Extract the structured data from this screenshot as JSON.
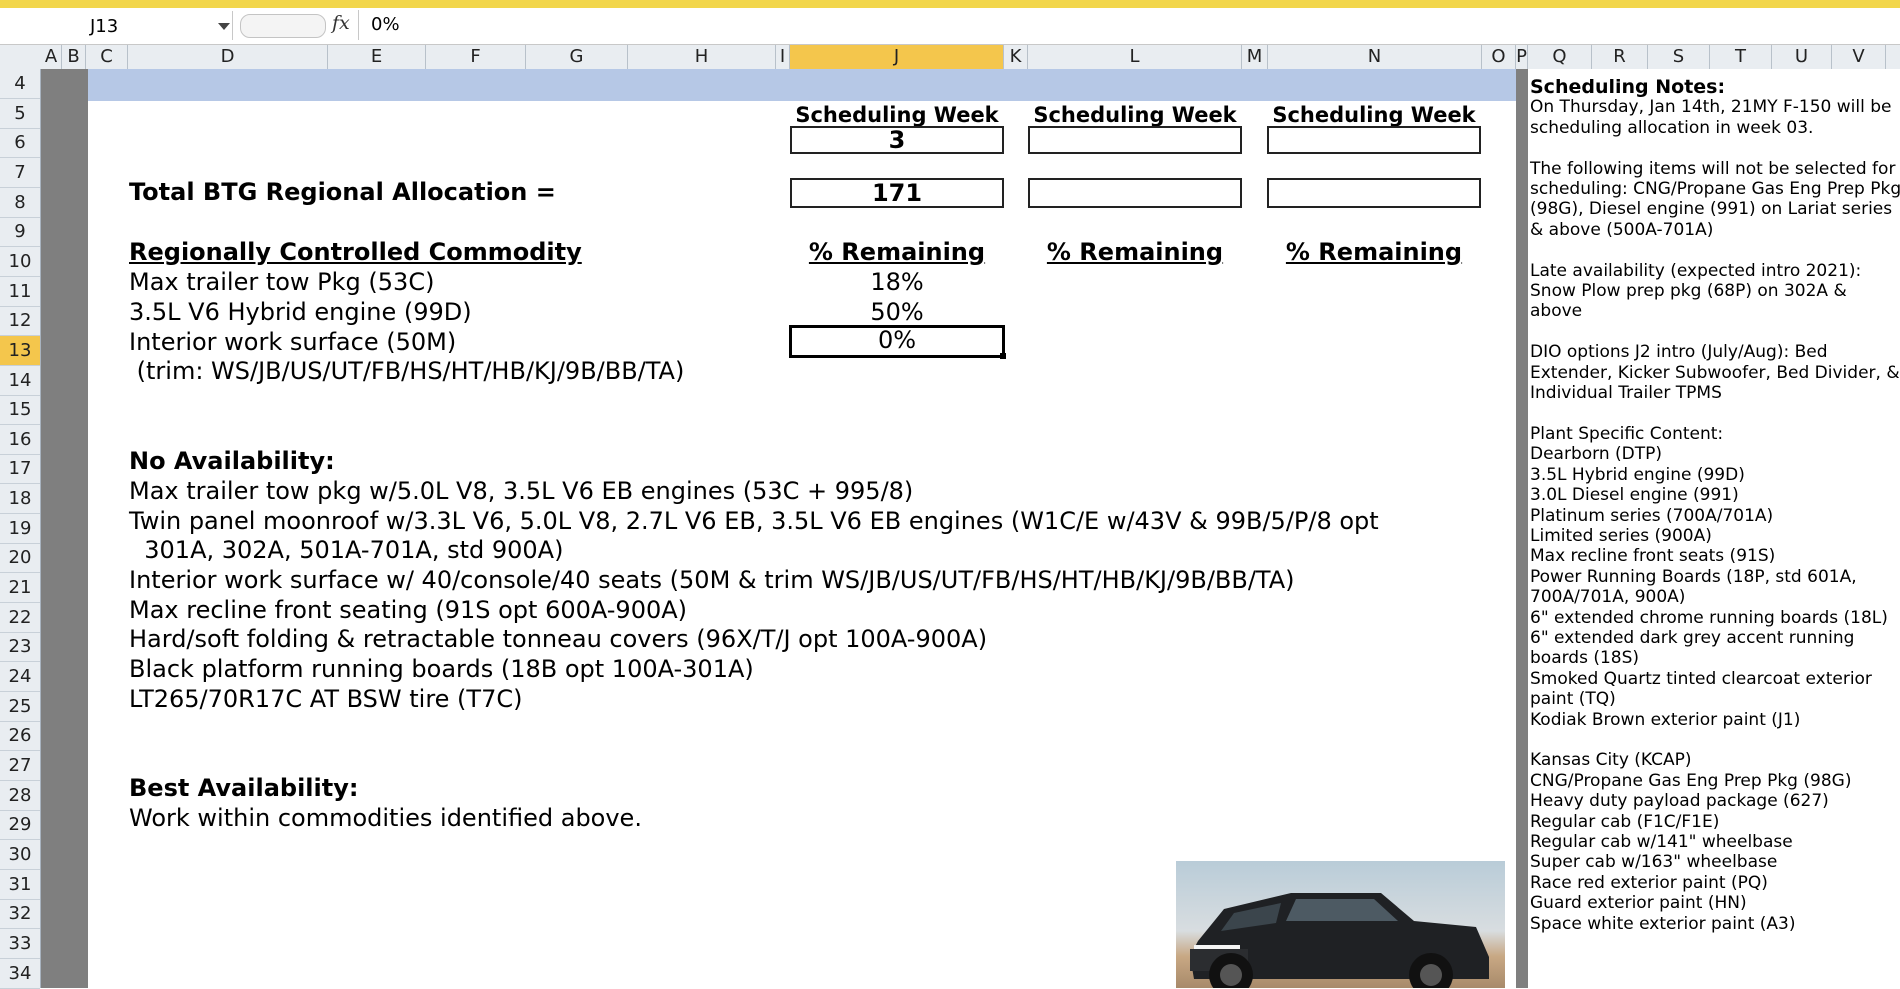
{
  "formula_bar": {
    "name_box": "J13",
    "fx_label": "fx",
    "value": "0%"
  },
  "columns": [
    "A",
    "B",
    "C",
    "D",
    "E",
    "F",
    "G",
    "H",
    "I",
    "J",
    "K",
    "L",
    "M",
    "N",
    "O",
    "P",
    "Q",
    "R",
    "S",
    "T",
    "U",
    "V"
  ],
  "active_column": "J",
  "rows": [
    "4",
    "5",
    "6",
    "7",
    "8",
    "9",
    "10",
    "11",
    "12",
    "13",
    "14",
    "15",
    "16",
    "17",
    "18",
    "19",
    "20",
    "21",
    "22",
    "23",
    "24",
    "25",
    "26",
    "27",
    "28",
    "29",
    "30",
    "31",
    "32",
    "33",
    "34"
  ],
  "active_row": "13",
  "scheduling_week_label": "Scheduling Week",
  "scheduling_week_values": [
    "3",
    "",
    ""
  ],
  "allocation_label": "Total BTG Regional Allocation =",
  "allocation_values": [
    "171",
    "",
    ""
  ],
  "commodity_header": "Regionally Controlled Commodity",
  "remaining_label": "% Remaining",
  "commodities": [
    {
      "name": "Max trailer tow Pkg (53C)",
      "remaining": "18%"
    },
    {
      "name": "3.5L V6 Hybrid engine (99D)",
      "remaining": "50%"
    },
    {
      "name": "Interior work surface (50M)",
      "remaining": "0%"
    }
  ],
  "commodity_trim_note": " (trim: WS/JB/US/UT/FB/HS/HT/HB/KJ/9B/BB/TA)",
  "no_availability": {
    "header": "No Availability:",
    "lines": [
      "Max trailer tow pkg w/5.0L V8, 3.5L V6 EB engines (53C + 995/8)",
      "Twin panel moonroof w/3.3L V6, 5.0L V8, 2.7L V6 EB, 3.5L V6 EB engines (W1C/E w/43V & 99B/5/P/8 opt",
      "  301A, 302A, 501A-701A, std 900A)",
      "Interior work surface w/ 40/console/40 seats (50M & trim WS/JB/US/UT/FB/HS/HT/HB/KJ/9B/BB/TA)",
      "Max recline front seating (91S opt 600A-900A)",
      "Hard/soft folding & retractable tonneau covers (96X/T/J opt 100A-900A)",
      "Black platform running boards (18B opt 100A-301A)",
      "LT265/70R17C AT BSW tire (T7C)"
    ]
  },
  "best_availability": {
    "header": "Best Availability:",
    "line": "Work within commodities identified above."
  },
  "notes": {
    "title": "Scheduling Notes:",
    "lines": [
      "On Thursday, Jan 14th, 21MY F-150 will be",
      "scheduling allocation in week 03.",
      "",
      "The following items will not be selected for",
      "scheduling: CNG/Propane Gas Eng Prep Pkg",
      "(98G), Diesel engine (991) on Lariat series",
      "& above (500A-701A)",
      "",
      "Late availability (expected intro 2021):",
      "Snow Plow prep pkg (68P) on 302A &",
      "above",
      "",
      "DIO options J2 intro (July/Aug): Bed",
      "Extender, Kicker Subwoofer, Bed Divider, &",
      "Individual Trailer TPMS",
      "",
      "Plant Specific Content:",
      "Dearborn (DTP)",
      "3.5L Hybrid engine (99D)",
      "3.0L Diesel engine (991)",
      "Platinum series (700A/701A)",
      "Limited series (900A)",
      "Max recline front seats (91S)",
      "Power Running Boards (18P, std 601A,",
      "700A/701A, 900A)",
      "6\" extended chrome running boards (18L)",
      "6\" extended dark grey accent running",
      "boards (18S)",
      "Smoked Quartz tinted clearcoat exterior",
      "paint (TQ)",
      "Kodiak Brown exterior paint (J1)",
      "",
      "Kansas City (KCAP)",
      "CNG/Propane Gas Eng Prep Pkg (98G)",
      "Heavy duty payload package (627)",
      "Regular cab (F1C/F1E)",
      "Regular cab w/141\" wheelbase",
      "Super cab w/163\" wheelbase",
      "Race red exterior paint (PQ)",
      "Guard exterior paint (HN)",
      "Space white exterior paint (A3)"
    ]
  },
  "colors": {
    "header_band": "#b6c8e6",
    "active_header": "#f4c64c",
    "grey_column": "#7f7f7f"
  }
}
